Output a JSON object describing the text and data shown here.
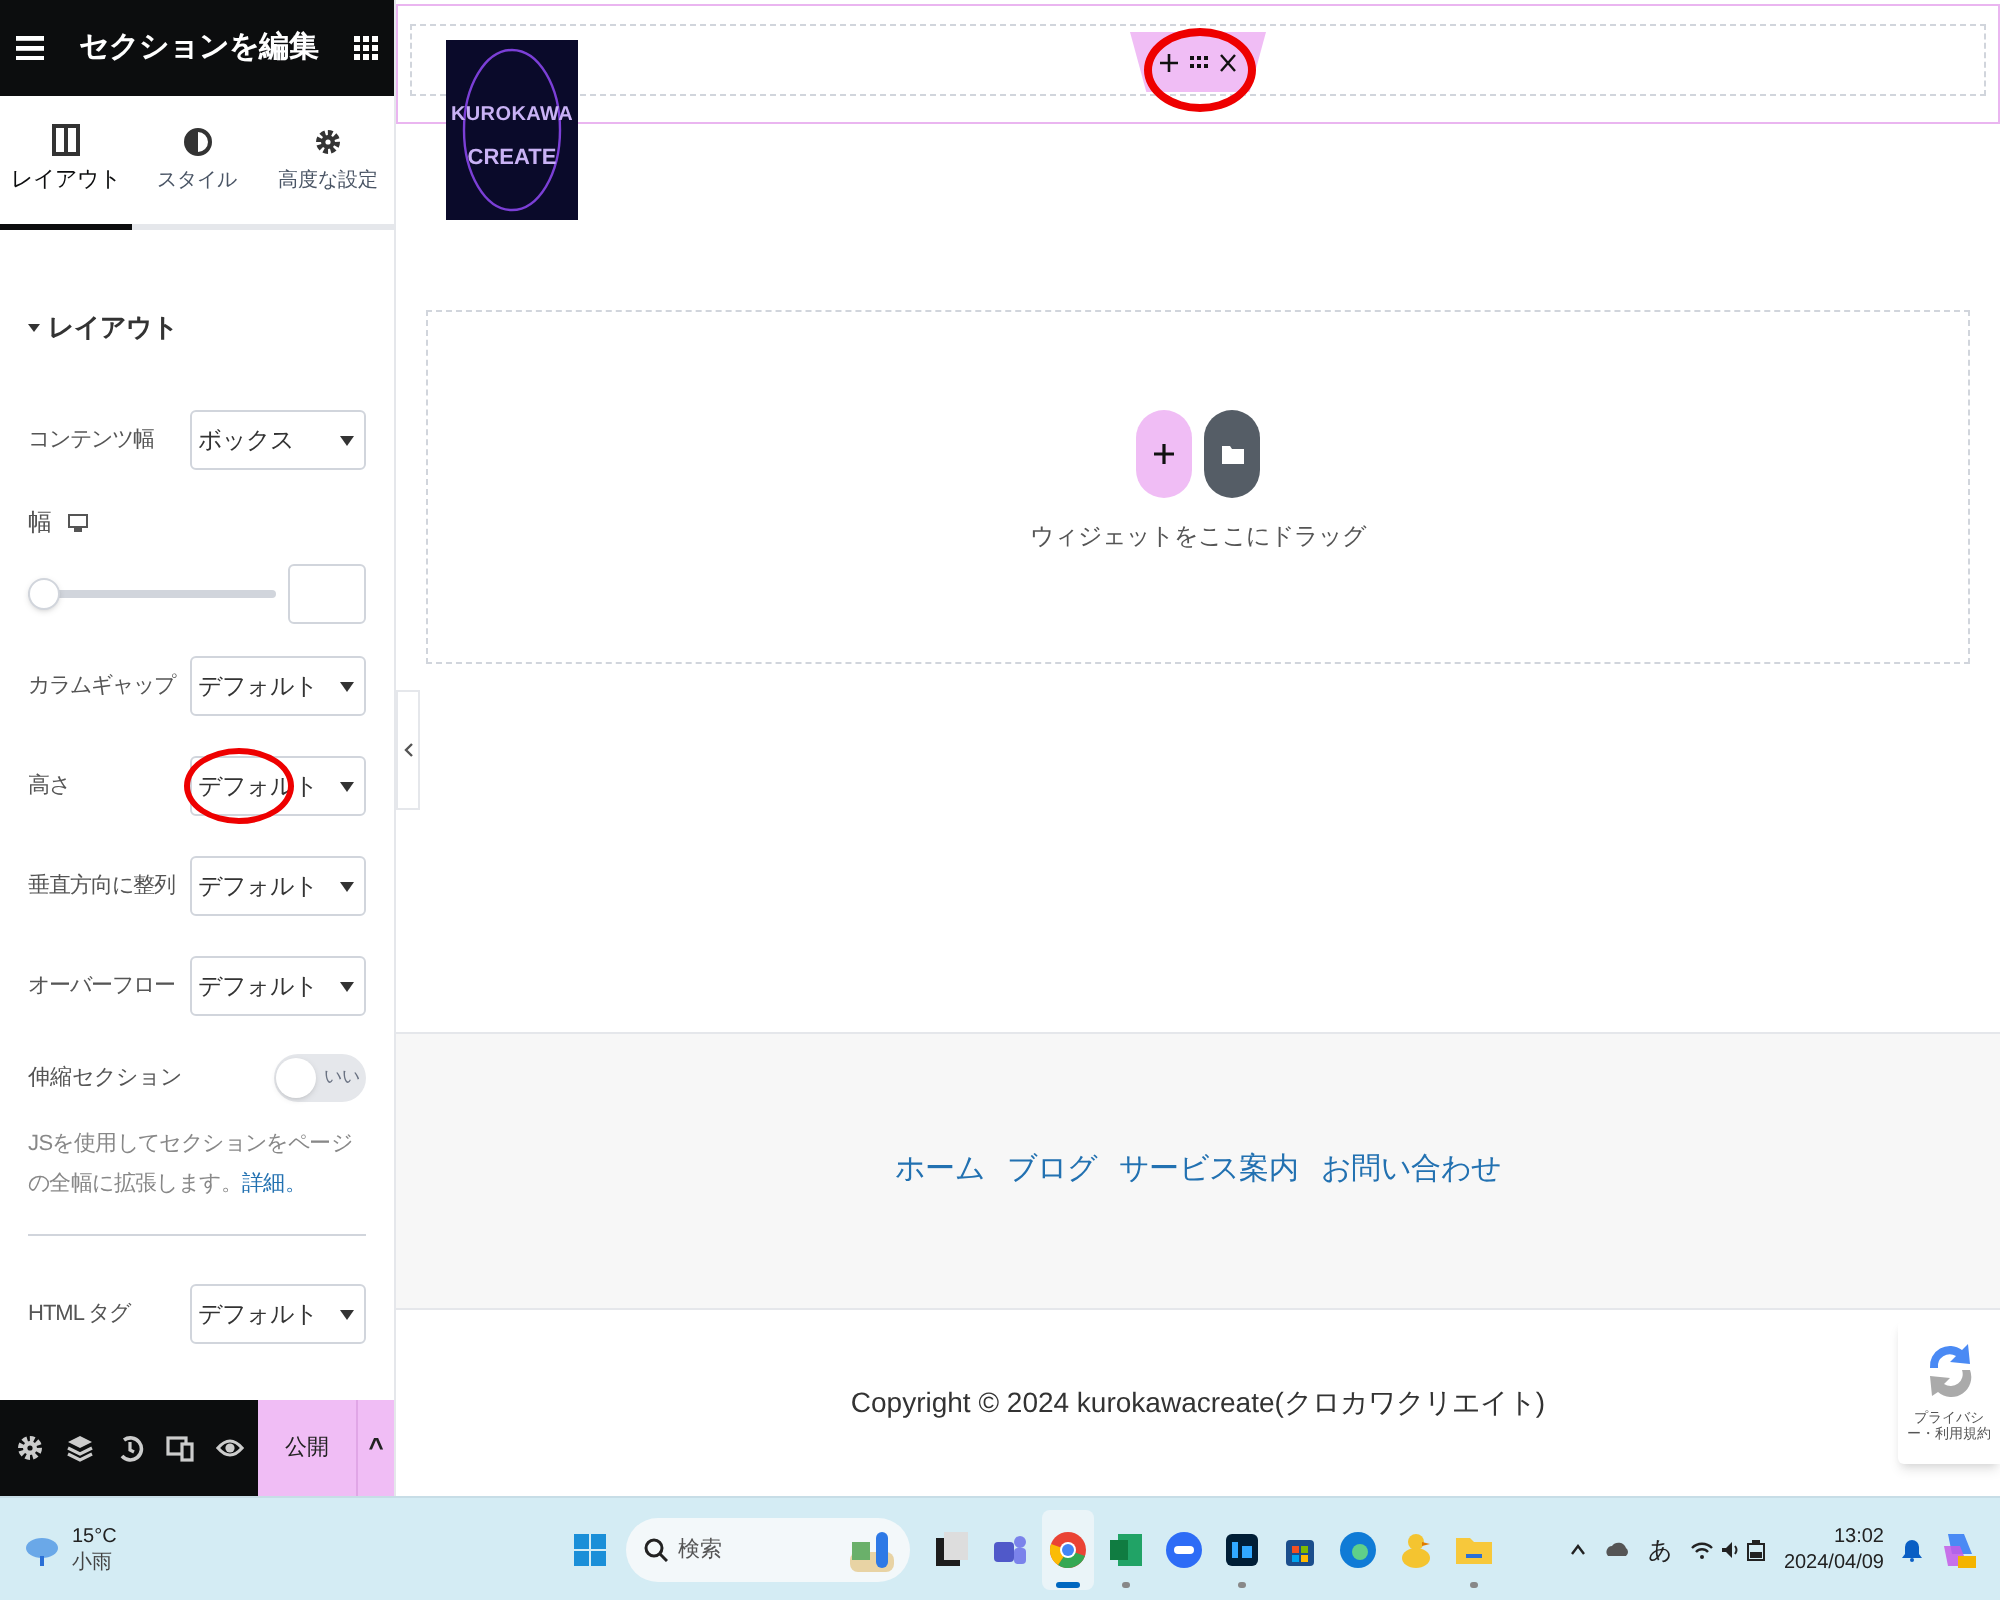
{
  "panel": {
    "title": "セクションを編集",
    "tabs": [
      {
        "kind": "layout",
        "label": "レイアウト",
        "selected": true
      },
      {
        "kind": "style",
        "label": "スタイル",
        "selected": false
      },
      {
        "kind": "advanced",
        "label": "高度な設定",
        "selected": false
      }
    ],
    "section": {
      "title": "レイアウト",
      "expanded": true
    },
    "controls": [
      {
        "kind": "select",
        "label": "コンテンツ幅",
        "value": "ボックス"
      },
      {
        "kind": "slider",
        "label": "幅",
        "level": 0
      },
      {
        "kind": "select",
        "label": "カラムギャップ",
        "value": "デフォルト"
      },
      {
        "kind": "select",
        "label": "高さ",
        "value": "デフォルト",
        "highlighted": true
      },
      {
        "kind": "select",
        "label": "垂直方向に整列",
        "value": "デフォルト"
      },
      {
        "kind": "select",
        "label": "オーバーフロー",
        "value": "デフォルト"
      },
      {
        "kind": "toggle",
        "label": "伸縮セクション",
        "on": false,
        "toggle_text": "いい"
      },
      {
        "kind": "note",
        "text": "JSを使用してセクションをページの全幅に拡張します。",
        "link": "詳細。"
      },
      {
        "kind": "divider"
      },
      {
        "kind": "select",
        "label": "HTML タグ",
        "value": "デフォルト"
      }
    ],
    "footer": {
      "publish": "公開",
      "caret": "^"
    }
  },
  "canvas": {
    "header_handle": {
      "highlighted": true
    },
    "logo": {
      "line_1": "KUROKAWA",
      "line_2": "CREATE"
    },
    "drop_zone": {
      "text": "ウィジェットをここにドラッグ"
    },
    "menu": [
      "ホーム",
      "ブログ",
      "サービス案内",
      "お問い合わせ"
    ],
    "copyright": "Copyright © 2024 kurokawacreate(クロカワクリエイト)",
    "recaptcha": "プライバシー・利用規約"
  },
  "taskbar": {
    "weather": {
      "temp": "15°C",
      "condition": "小雨"
    },
    "search": {
      "placeholder": "検索"
    },
    "apps": [
      {
        "kind": "files",
        "running": false,
        "selected": false
      },
      {
        "kind": "teams",
        "running": false,
        "selected": false
      },
      {
        "kind": "chrome",
        "running": true,
        "selected": true
      },
      {
        "kind": "excel",
        "running": true,
        "selected": false
      },
      {
        "kind": "zoom",
        "running": false,
        "selected": false
      },
      {
        "kind": "photoshop",
        "running": true,
        "selected": false
      },
      {
        "kind": "store",
        "running": false,
        "selected": false
      },
      {
        "kind": "edge",
        "running": false,
        "selected": false
      },
      {
        "kind": "duck",
        "running": false,
        "selected": false
      },
      {
        "kind": "folder",
        "running": true,
        "selected": false
      }
    ],
    "ime": "あ",
    "time": "13:02",
    "date": "2024/04/09"
  }
}
